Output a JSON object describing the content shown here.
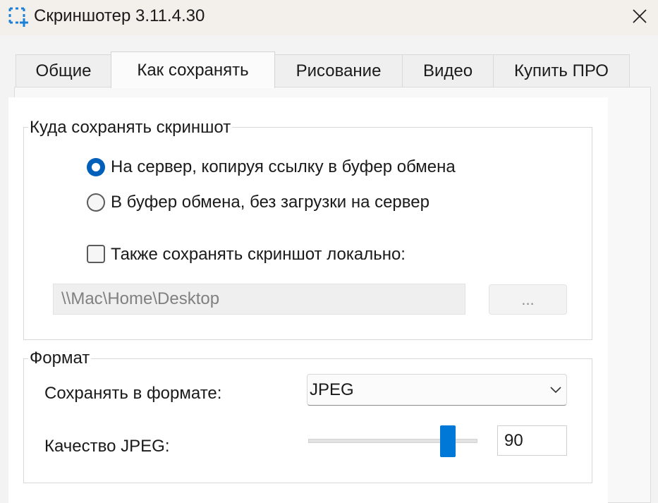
{
  "window": {
    "title": "Скриншотер 3.11.4.30",
    "app_icon": "screenshot-frame-icon",
    "close_icon": "close-icon"
  },
  "tabs": [
    {
      "label": "Общие",
      "active": false
    },
    {
      "label": "Как сохранять",
      "active": true
    },
    {
      "label": "Рисование",
      "active": false
    },
    {
      "label": "Видео",
      "active": false
    },
    {
      "label": "Купить ПРО",
      "active": false
    }
  ],
  "save_location": {
    "group_label": "Куда сохранять скриншот",
    "options": [
      {
        "label": "На сервер, копируя ссылку в буфер обмена",
        "checked": true
      },
      {
        "label": "В буфер обмена, без загрузки на сервер",
        "checked": false
      }
    ],
    "save_locally": {
      "label": "Также сохранять скриншот локально:",
      "checked": false
    },
    "path_value": "\\\\Mac\\Home\\Desktop",
    "browse_label": "..."
  },
  "format": {
    "group_label": "Формат",
    "format_label": "Сохранять в формате:",
    "format_value": "JPEG",
    "quality_label": "Качество JPEG:",
    "quality_value": "90"
  },
  "colors": {
    "accent": "#005fb8",
    "slider_thumb": "#0078d7"
  }
}
